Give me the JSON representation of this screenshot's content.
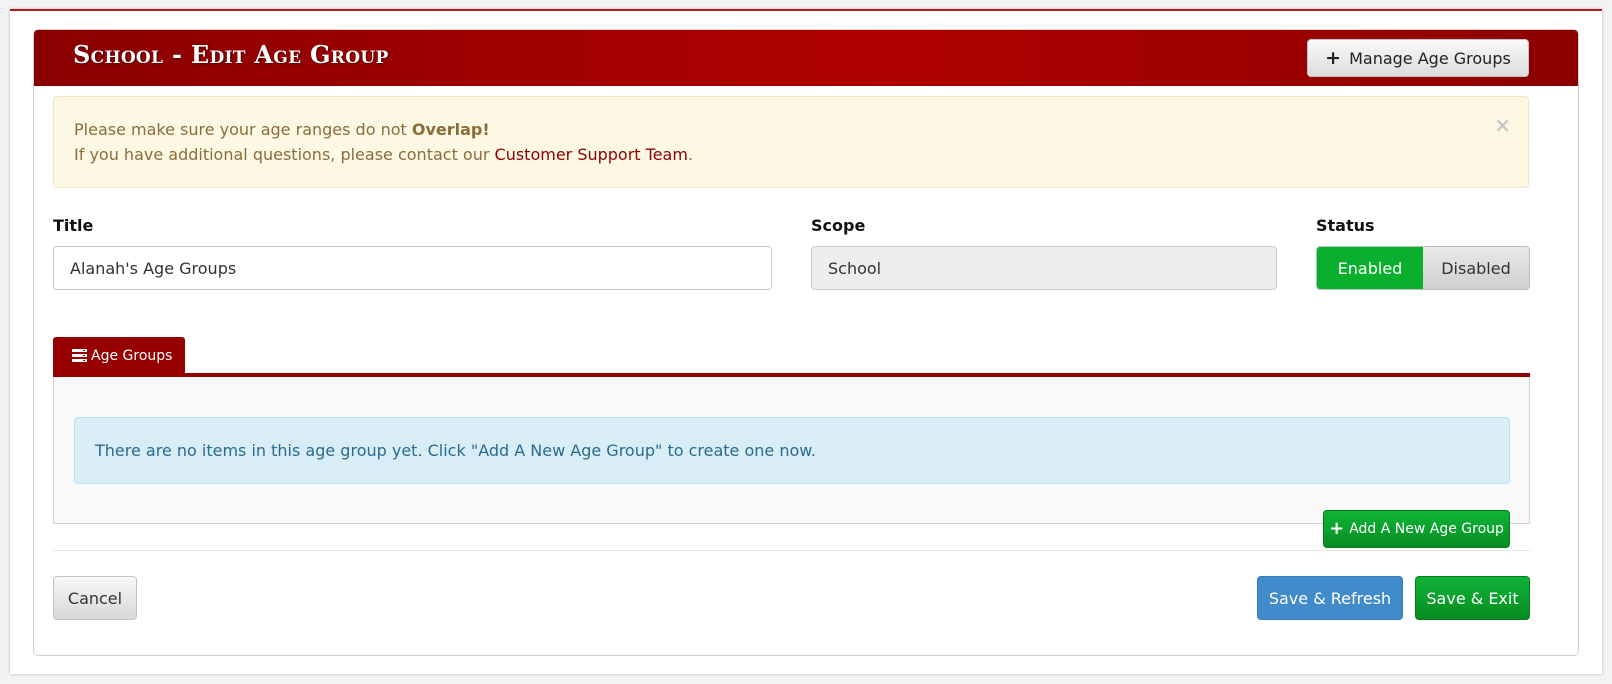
{
  "header": {
    "title": "School - Edit Age Group",
    "manage_button_label": "Manage Age Groups"
  },
  "alert": {
    "line1_prefix": "Please make sure your age ranges do not ",
    "line1_strong": "Overlap!",
    "line2_prefix": "If you have additional questions, please contact our ",
    "line2_link": "Customer Support Team",
    "line2_suffix": ".",
    "close_glyph": "×"
  },
  "form": {
    "title_label": "Title",
    "title_value": "Alanah's Age Groups",
    "scope_label": "Scope",
    "scope_value": "School",
    "status_label": "Status",
    "status_options": [
      "Enabled",
      "Disabled"
    ],
    "status_selected": "Enabled"
  },
  "tabs": [
    {
      "label": "Age Groups",
      "icon": "list-icon"
    }
  ],
  "age_groups": {
    "empty_message": "There are no items in this age group yet. Click \"Add A New Age Group\" to create one now.",
    "add_button_label": "Add A New Age Group"
  },
  "footer": {
    "cancel_label": "Cancel",
    "save_refresh_label": "Save & Refresh",
    "save_exit_label": "Save & Exit"
  },
  "colors": {
    "header_red": "#960000",
    "success_green": "#0ab02d",
    "primary_blue": "#428bca",
    "warning_bg": "#fcf8e3",
    "info_bg": "#d9edf7"
  }
}
